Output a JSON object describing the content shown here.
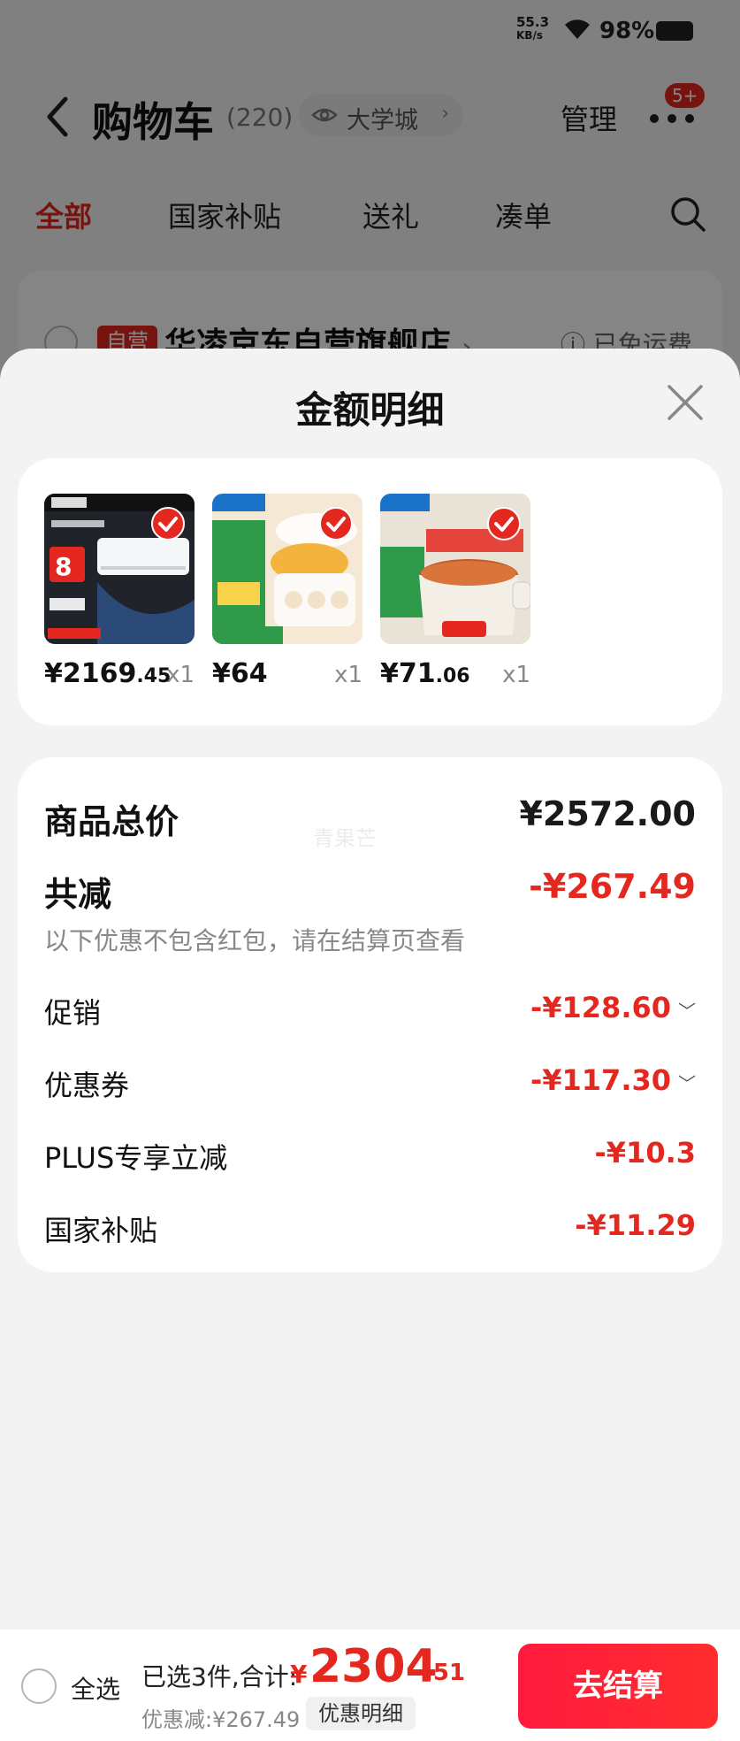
{
  "status_bar": {
    "net_speed_value": "55.3",
    "net_speed_unit": "KB/s",
    "battery": "98%"
  },
  "header": {
    "title": "购物车",
    "count": "(220)",
    "location": "大学城",
    "manage": "管理",
    "more_badge": "5+"
  },
  "tabs": [
    {
      "label": "全部",
      "active": true
    },
    {
      "label": "国家补贴",
      "active": false
    },
    {
      "label": "送礼",
      "active": false
    },
    {
      "label": "凑单",
      "active": false
    }
  ],
  "store": {
    "badge": "自营",
    "name": "华凌京东自营旗舰店",
    "chevron": "›",
    "shipping": "ⓘ 已免运费"
  },
  "sheet": {
    "title": "金额明细",
    "products": [
      {
        "price_int": "¥2169",
        "price_dec": ".45",
        "qty": "x1"
      },
      {
        "price_int": "¥64",
        "price_dec": "",
        "qty": "x1"
      },
      {
        "price_int": "¥71",
        "price_dec": ".06",
        "qty": "x1"
      }
    ],
    "summary": {
      "total_label": "商品总价",
      "total_value": "¥2572.00",
      "watermark": "青果芒",
      "reduction_label": "共减",
      "reduction_value": "-¥267.49",
      "note": "以下优惠不包含红包，请在结算页查看",
      "items": [
        {
          "label": "促销",
          "value": "-¥128.60",
          "expandable": true
        },
        {
          "label": "优惠券",
          "value": "-¥117.30",
          "expandable": true
        },
        {
          "label": "PLUS专享立减",
          "value": "-¥10.3",
          "expandable": false
        },
        {
          "label": "国家补贴",
          "value": "-¥11.29",
          "expandable": false
        }
      ]
    }
  },
  "checkout": {
    "select_all": "全选",
    "selected_text": "已选3件,合计:",
    "currency": "¥",
    "total_int": "2304",
    "total_dec": ".51",
    "discount_text": "优惠减:¥267.49",
    "detail_button": "优惠明细",
    "checkout_button": "去结算"
  },
  "colors": {
    "accent_red": "#e4281f",
    "checkout_red": "#ff1a3e"
  }
}
